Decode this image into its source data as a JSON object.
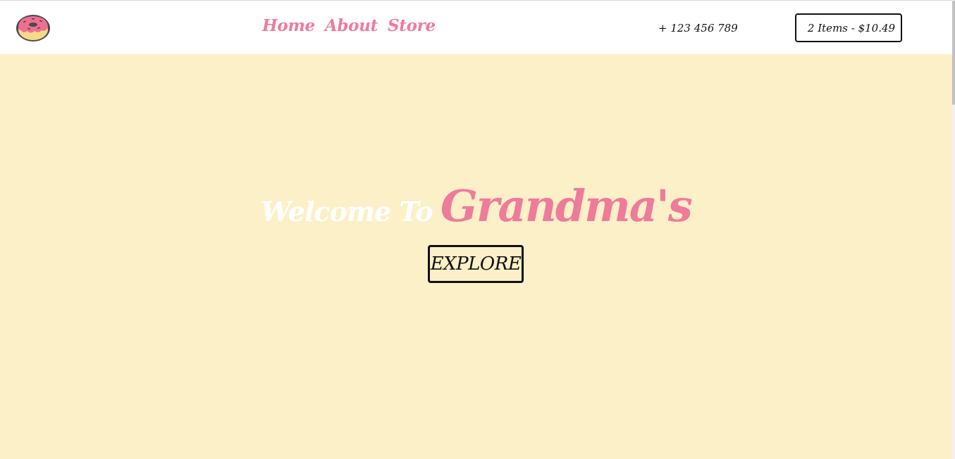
{
  "colors": {
    "accent": "#ef7b9b",
    "background": "#fcf0c8",
    "navbar": "#ffffff",
    "text": "#111111"
  },
  "header": {
    "logo_icon": "donut-icon",
    "nav": [
      {
        "label": "Home"
      },
      {
        "label": "About"
      },
      {
        "label": "Store"
      }
    ],
    "phone": "+ 123 456 789",
    "cart_label": "2 Items - $10.49"
  },
  "hero": {
    "welcome": "Welcome To",
    "brand": "Grandma's",
    "button_label": "EXPLORE"
  }
}
